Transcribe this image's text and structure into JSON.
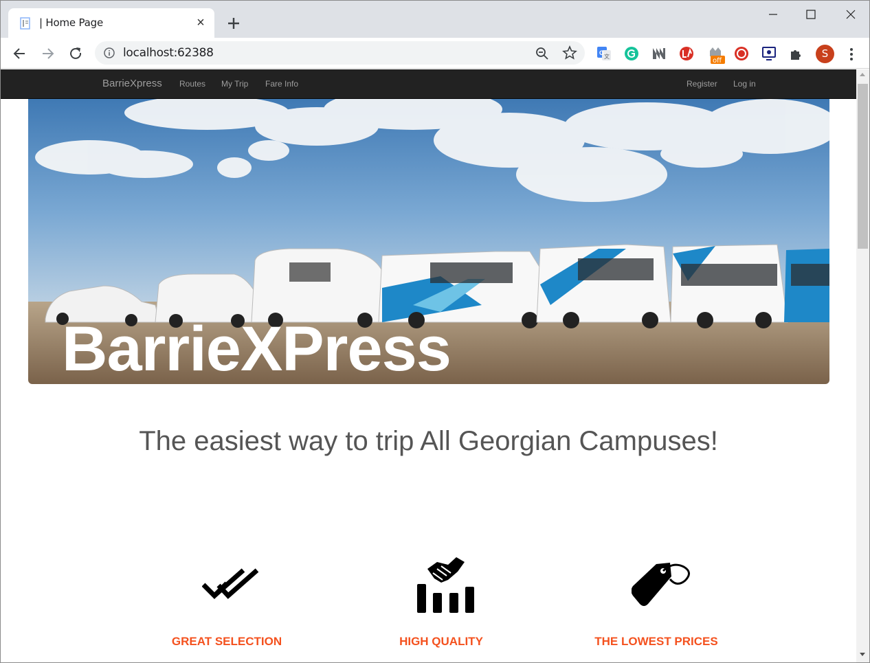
{
  "browser": {
    "tab": {
      "title": "| Home Page",
      "close_icon": "×",
      "favicon": "page-icon"
    },
    "new_tab_icon": "plus-icon",
    "omnibox": {
      "url": "localhost:62388",
      "info_icon": "info-icon",
      "zoom_icon": "zoom-icon",
      "bookmark_icon": "star-icon"
    },
    "extensions": [
      "google-translate-icon",
      "grammarly-icon",
      "extension-m-icon",
      "extension-red-icon",
      "extension-off-icon",
      "record-icon",
      "screen-icon",
      "puzzle-icon"
    ],
    "extension_badge": "off",
    "profile_initial": "S",
    "colors": {
      "tabstrip": "#dee1e6",
      "profile": "#c8401c",
      "badge": "#f57c00"
    }
  },
  "site": {
    "brand": "BarrieXpress",
    "nav": [
      {
        "label": "Routes"
      },
      {
        "label": "My Trip"
      },
      {
        "label": "Fare Info"
      }
    ],
    "account": [
      {
        "label": "Register"
      },
      {
        "label": "Log in"
      }
    ],
    "hero_title": "BarrieXPress",
    "tagline": "The easiest way to trip All Georgian Campuses!",
    "features": [
      {
        "heading": "GREAT SELECTION",
        "icon": "double-check-icon"
      },
      {
        "heading": "HIGH QUALITY",
        "icon": "handshake-chart-icon"
      },
      {
        "heading": "THE LOWEST PRICES",
        "icon": "price-tag-icon"
      }
    ],
    "colors": {
      "navbar": "#222222",
      "accent": "#f4511e",
      "text": "#555555"
    }
  }
}
